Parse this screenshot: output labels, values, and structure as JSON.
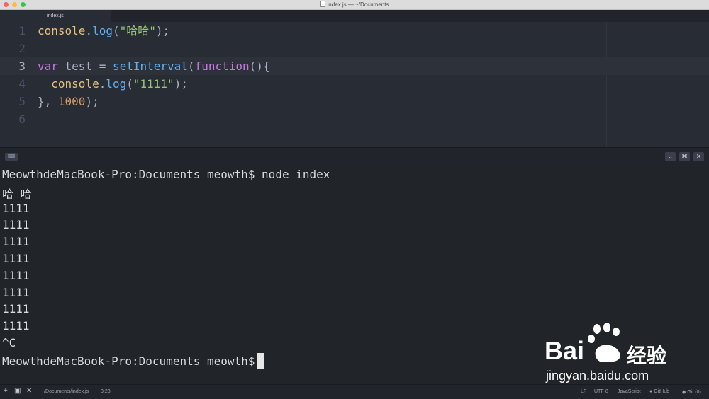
{
  "window": {
    "title": "index.js — ~/Documents"
  },
  "tabs": [
    {
      "label": "index.js"
    }
  ],
  "editor": {
    "line_numbers": [
      "1",
      "2",
      "3",
      "4",
      "5",
      "6"
    ],
    "lines": [
      [
        {
          "t": "console",
          "c": "obj"
        },
        {
          "t": ".",
          "c": "pl"
        },
        {
          "t": "log",
          "c": "fn"
        },
        {
          "t": "(",
          "c": "pl"
        },
        {
          "t": "\"哈哈\"",
          "c": "str"
        },
        {
          "t": ");",
          "c": "pl"
        }
      ],
      [],
      [
        {
          "t": "var",
          "c": "kw"
        },
        {
          "t": " test = ",
          "c": "pl"
        },
        {
          "t": "setInterval",
          "c": "fn"
        },
        {
          "t": "(",
          "c": "pl"
        },
        {
          "t": "function",
          "c": "kw"
        },
        {
          "t": "(){",
          "c": "pl"
        }
      ],
      [
        {
          "t": "  ",
          "c": "pl"
        },
        {
          "t": "console",
          "c": "obj"
        },
        {
          "t": ".",
          "c": "pl"
        },
        {
          "t": "log",
          "c": "fn"
        },
        {
          "t": "(",
          "c": "pl"
        },
        {
          "t": "\"1111\"",
          "c": "str"
        },
        {
          "t": ");",
          "c": "pl"
        }
      ],
      [
        {
          "t": "}, ",
          "c": "pl"
        },
        {
          "t": "1000",
          "c": "num"
        },
        {
          "t": ");",
          "c": "pl"
        }
      ],
      []
    ],
    "active_line": 3
  },
  "terminal": {
    "badge": "⌨",
    "lines": [
      "MeowthdeMacBook-Pro:Documents meowth$ node index",
      "哈 哈",
      "1111",
      "1111",
      "1111",
      "1111",
      "1111",
      "1111",
      "1111",
      "1111",
      "^C"
    ],
    "prompt": "MeowthdeMacBook-Pro:Documents meowth$"
  },
  "status_bar": {
    "add": "+",
    "file_path": "~/Documents/index.js",
    "cursor_pos": "3:23",
    "line_ending": "LF",
    "encoding": "UTF-8",
    "grammar": "JavaScript",
    "github": "GitHub",
    "git": "Git (0)"
  },
  "watermark": {
    "brand": "Bai",
    "brand_tail": "经验",
    "url": "jingyan.baidu.com"
  },
  "colors": {
    "keyword": "#c678dd",
    "function": "#61afef",
    "object": "#e5c07b",
    "string": "#98c379",
    "number": "#d19a66"
  }
}
